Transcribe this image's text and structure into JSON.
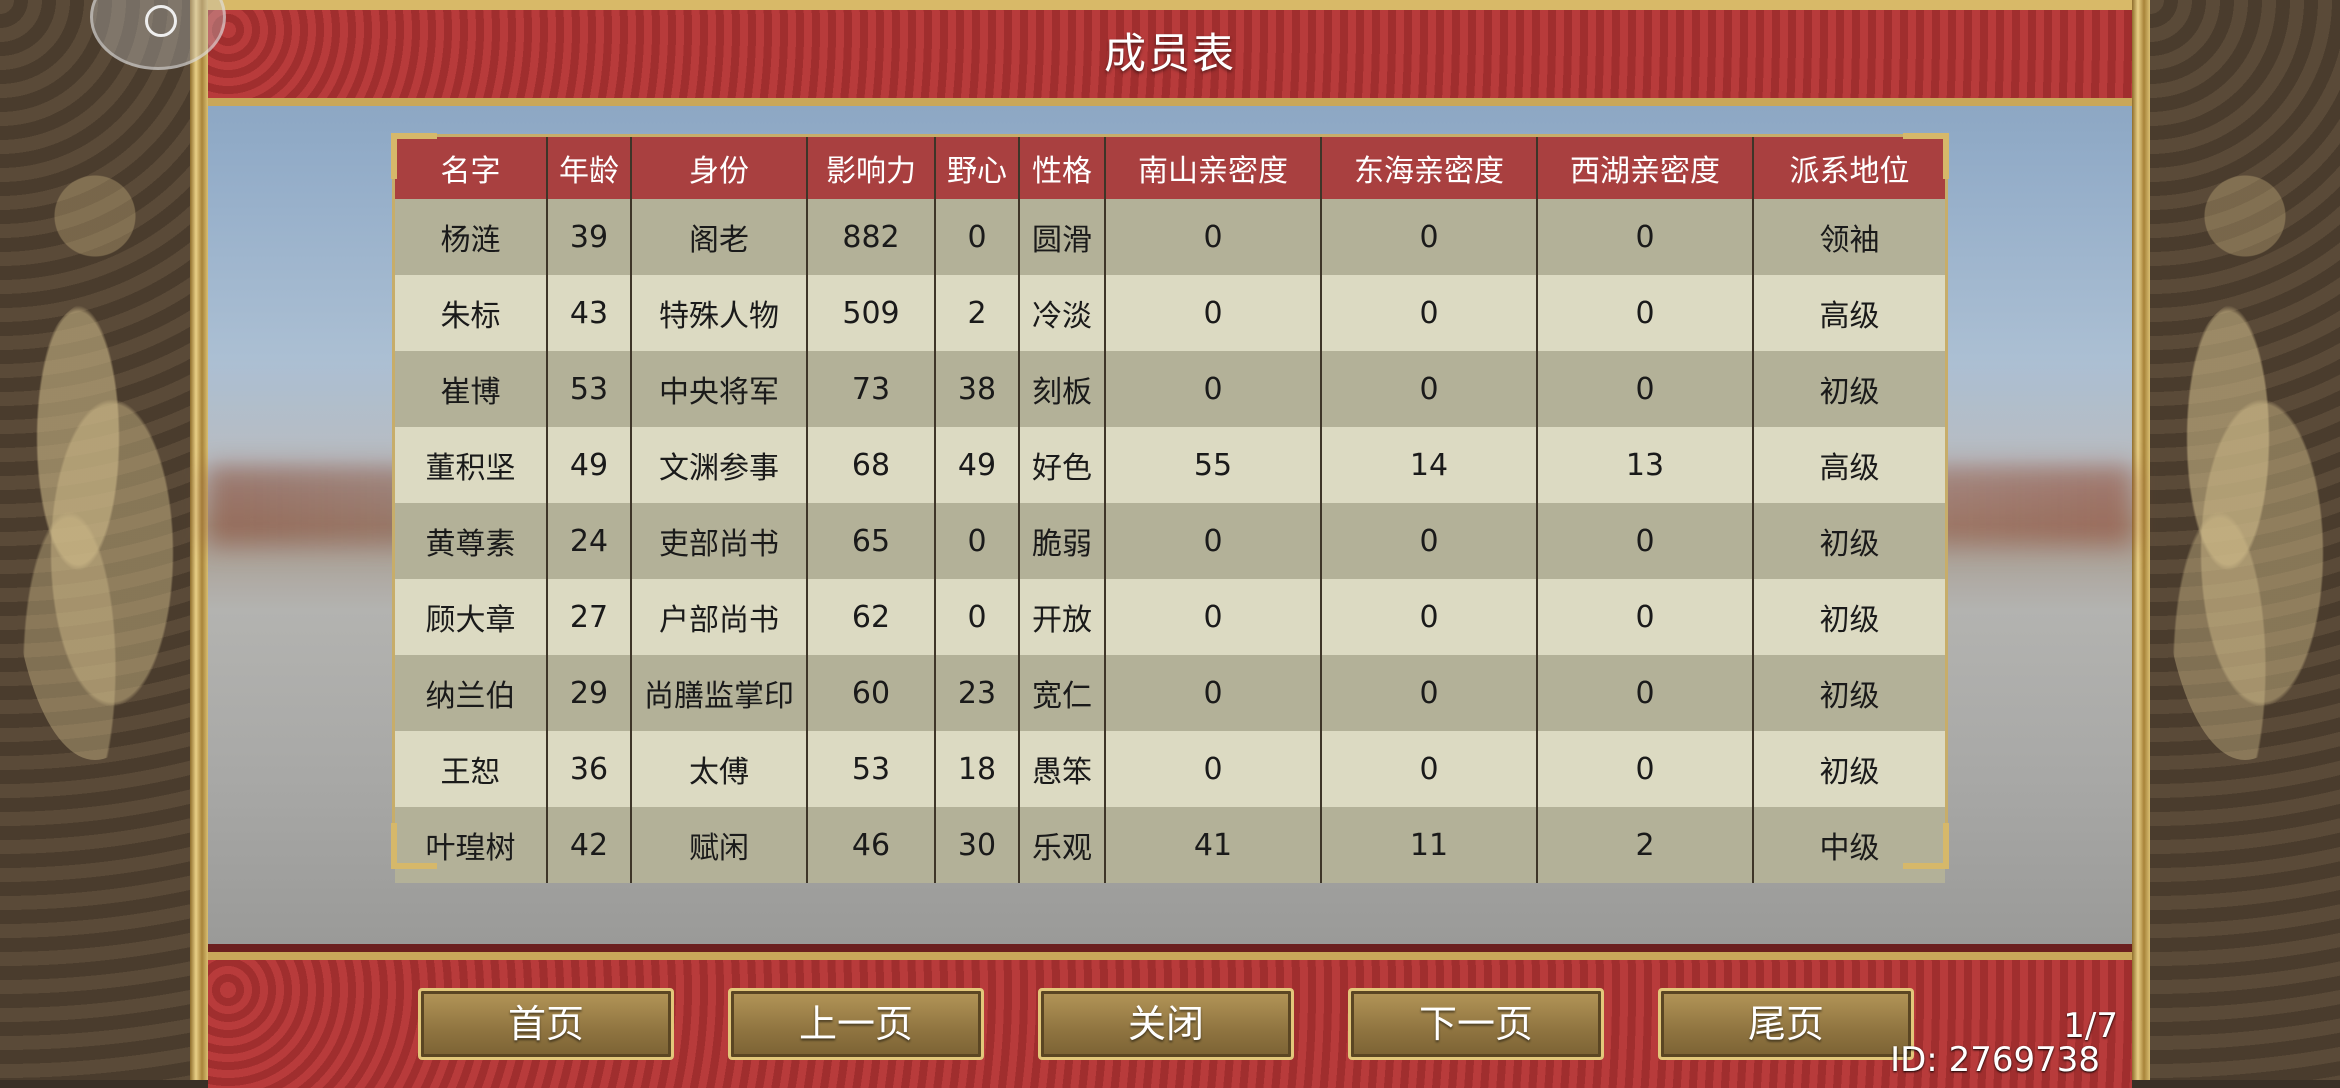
{
  "header": {
    "title": "成员表"
  },
  "table": {
    "columns": [
      "名字",
      "年龄",
      "身份",
      "影响力",
      "野心",
      "性格",
      "南山亲密度",
      "东海亲密度",
      "西湖亲密度",
      "派系地位"
    ],
    "rows": [
      [
        "杨涟",
        "39",
        "阁老",
        "882",
        "0",
        "圆滑",
        "0",
        "0",
        "0",
        "领袖"
      ],
      [
        "朱标",
        "43",
        "特殊人物",
        "509",
        "2",
        "冷淡",
        "0",
        "0",
        "0",
        "高级"
      ],
      [
        "崔博",
        "53",
        "中央将军",
        "73",
        "38",
        "刻板",
        "0",
        "0",
        "0",
        "初级"
      ],
      [
        "董积坚",
        "49",
        "文渊参事",
        "68",
        "49",
        "好色",
        "55",
        "14",
        "13",
        "高级"
      ],
      [
        "黄尊素",
        "24",
        "吏部尚书",
        "65",
        "0",
        "脆弱",
        "0",
        "0",
        "0",
        "初级"
      ],
      [
        "顾大章",
        "27",
        "户部尚书",
        "62",
        "0",
        "开放",
        "0",
        "0",
        "0",
        "初级"
      ],
      [
        "纳兰伯",
        "29",
        "尚膳监掌印",
        "60",
        "23",
        "宽仁",
        "0",
        "0",
        "0",
        "初级"
      ],
      [
        "王恕",
        "36",
        "太傅",
        "53",
        "18",
        "愚笨",
        "0",
        "0",
        "0",
        "初级"
      ],
      [
        "叶瑝树",
        "42",
        "赋闲",
        "46",
        "30",
        "乐观",
        "41",
        "11",
        "2",
        "中级"
      ]
    ]
  },
  "footer": {
    "first_label": "首页",
    "prev_label": "上一页",
    "close_label": "关闭",
    "next_label": "下一页",
    "last_label": "尾页",
    "page_indicator": "1/7",
    "id_text": "ID: 2769738"
  },
  "colors": {
    "header_red": "#a94040",
    "row_dark": "#b3b198",
    "row_light": "#dcdac2",
    "gold": "#c9a75a"
  }
}
